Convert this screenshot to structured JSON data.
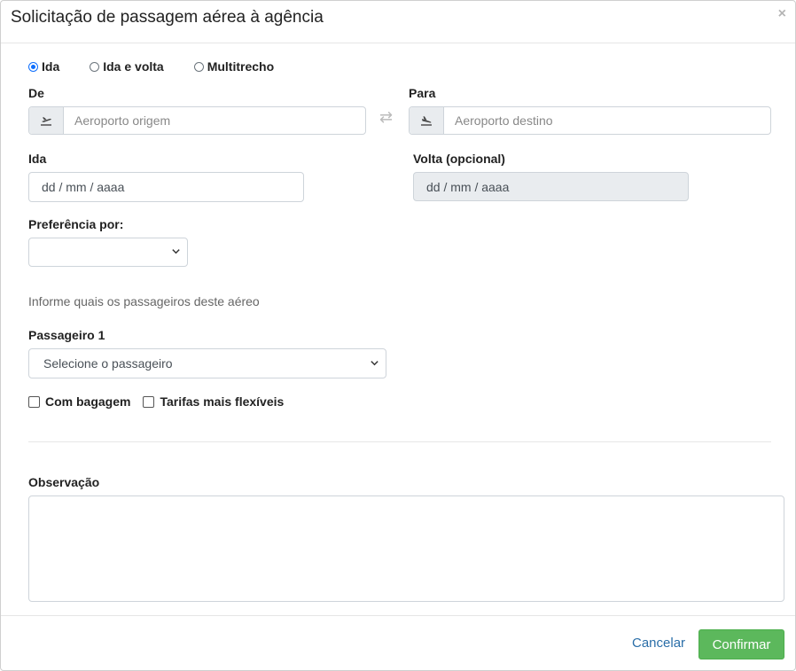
{
  "modal": {
    "title": "Solicitação de passagem aérea à agência",
    "close": "×"
  },
  "trip_type": {
    "options": [
      "Ida",
      "Ida e volta",
      "Multitrecho"
    ],
    "selected": "Ida"
  },
  "from": {
    "label": "De",
    "placeholder": "Aeroporto origem"
  },
  "to": {
    "label": "Para",
    "placeholder": "Aeroporto destino"
  },
  "swap_icon": "⇄",
  "departure": {
    "label": "Ida",
    "value": "dd / mm / aaaa"
  },
  "return": {
    "label": "Volta (opcional)",
    "value": "dd / mm / aaaa"
  },
  "preference": {
    "label": "Preferência por:",
    "value": ""
  },
  "passengers": {
    "help": "Informe quais os passageiros deste aéreo",
    "passenger1_label": "Passageiro 1",
    "passenger1_value": "Selecione o passageiro"
  },
  "options": {
    "baggage": "Com bagagem",
    "flexible": "Tarifas mais flexíveis"
  },
  "notes": {
    "label": "Observação",
    "value": ""
  },
  "footer": {
    "cancel": "Cancelar",
    "confirm": "Confirmar"
  },
  "colors": {
    "primary": "#0d6efd",
    "success": "#5cb85c",
    "link": "#2a6ea8"
  }
}
